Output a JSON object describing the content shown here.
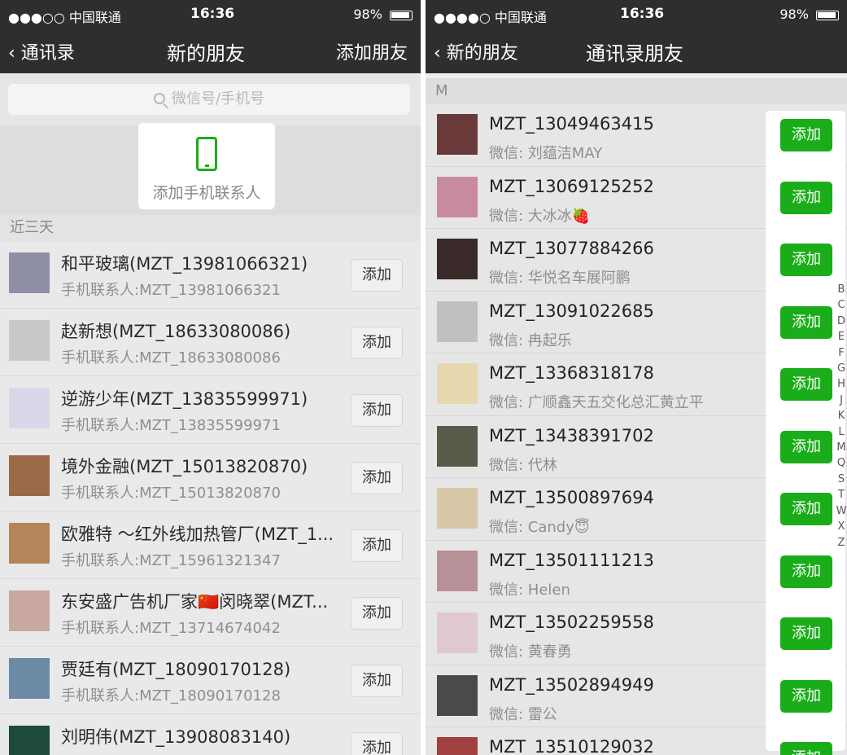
{
  "left_screen": {
    "status": {
      "carrier": "●●●○○ 中国联通",
      "time": "16:36",
      "battery": "98%"
    },
    "nav": {
      "back": "通讯录",
      "title": "新的朋友",
      "action": "添加朋友"
    },
    "search": {
      "placeholder": "微信号/手机号"
    },
    "add_phone": {
      "label": "添加手机联系人"
    },
    "section": "近三天",
    "button_label": "添加",
    "contacts": [
      {
        "name": "和平玻璃(MZT_13981066321)",
        "sub": "手机联系人:MZT_13981066321"
      },
      {
        "name": "赵新想(MZT_18633080086)",
        "sub": "手机联系人:MZT_18633080086"
      },
      {
        "name": "逆游少年(MZT_13835599971)",
        "sub": "手机联系人:MZT_13835599971"
      },
      {
        "name": "境外金融(MZT_15013820870)",
        "sub": "手机联系人:MZT_15013820870"
      },
      {
        "name": "欧雅特 ～红外线加热管厂(MZT_1...",
        "sub": "手机联系人:MZT_15961321347"
      },
      {
        "name": "东安盛广告机厂家🇨🇳闵晓翠(MZT...",
        "sub": "手机联系人:MZT_13714674042"
      },
      {
        "name": "贾廷有(MZT_18090170128)",
        "sub": "手机联系人:MZT_18090170128"
      },
      {
        "name": "刘明伟(MZT_13908083140)",
        "sub": ""
      }
    ]
  },
  "right_screen": {
    "status": {
      "carrier": "●●●●○ 中国联通",
      "time": "16:36",
      "battery": "98%"
    },
    "nav": {
      "back": "新的朋友",
      "title": "通讯录朋友"
    },
    "section": "M",
    "button_label": "添加",
    "index_letters": [
      "B",
      "C",
      "D",
      "E",
      "F",
      "G",
      "H",
      "J",
      "K",
      "L",
      "M",
      "Q",
      "S",
      "T",
      "W",
      "X",
      "Z"
    ],
    "contacts": [
      {
        "name": "MZT_13049463415",
        "sub": "微信:  刘蕴洁MAY"
      },
      {
        "name": "MZT_13069125252",
        "sub": "微信:  大冰冰🍓"
      },
      {
        "name": "MZT_13077884266",
        "sub": "微信:  华悦名车展阿鹏"
      },
      {
        "name": "MZT_13091022685",
        "sub": "微信:  冉起乐"
      },
      {
        "name": "MZT_13368318178",
        "sub": "微信:  广顺鑫天五交化总汇黄立平"
      },
      {
        "name": "MZT_13438391702",
        "sub": "微信:  代林"
      },
      {
        "name": "MZT_13500897694",
        "sub": "微信:  Candy😇"
      },
      {
        "name": "MZT_13501111213",
        "sub": "微信:  Helen"
      },
      {
        "name": "MZT_13502259558",
        "sub": "微信:  黄春勇"
      },
      {
        "name": "MZT_13502894949",
        "sub": "微信:  雷公"
      },
      {
        "name": "MZT_13510129032",
        "sub": ""
      }
    ]
  },
  "colors": {
    "accent_green": "#1aad19",
    "navbar": "#2e2e2e"
  }
}
